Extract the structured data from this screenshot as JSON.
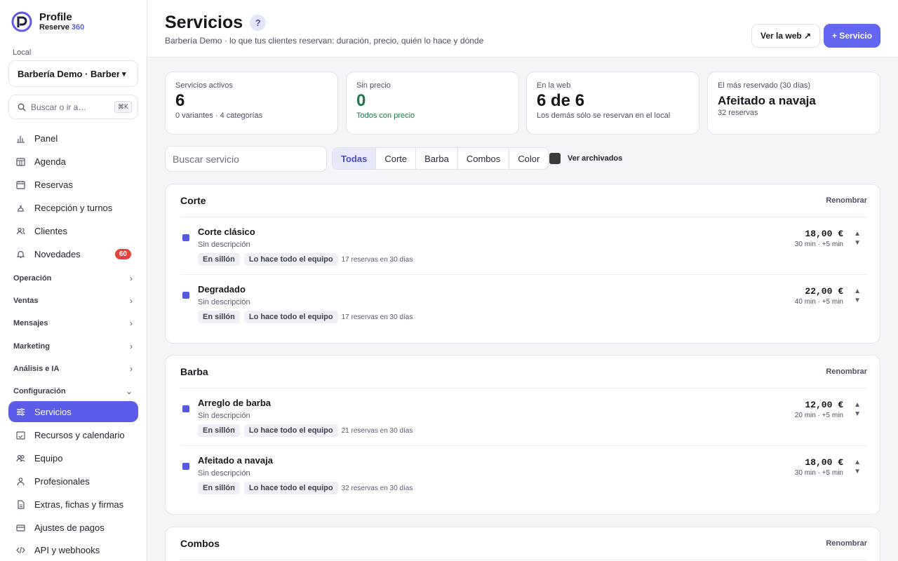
{
  "brand": {
    "line1": "Profile",
    "line2_prefix": "Reserve",
    "line2_accent": "360",
    "accent": "#5b5ce8"
  },
  "sidebar": {
    "local_label": "Local",
    "local_value": "Barbería Demo · Barbería",
    "search_placeholder": "Buscar o ir a…",
    "search_shortcut": "⌘K",
    "items": [
      {
        "label": "Panel",
        "icon": "chart-icon"
      },
      {
        "label": "Agenda",
        "icon": "calendar-grid-icon"
      },
      {
        "label": "Reservas",
        "icon": "calendar-icon"
      },
      {
        "label": "Recepción y turnos",
        "icon": "bell-desk-icon"
      },
      {
        "label": "Clientes",
        "icon": "users-icon"
      },
      {
        "label": "Novedades",
        "icon": "bell-icon",
        "badge": "60"
      }
    ],
    "groups": [
      "Operación",
      "Ventas",
      "Mensajes",
      "Marketing",
      "Análisis e IA",
      "Configuración"
    ],
    "config_items": [
      {
        "label": "Servicios",
        "icon": "sliders-icon",
        "active": true
      },
      {
        "label": "Recursos y calendario",
        "icon": "calendar-check-icon"
      },
      {
        "label": "Equipo",
        "icon": "team-icon"
      },
      {
        "label": "Profesionales",
        "icon": "person-icon"
      },
      {
        "label": "Extras, fichas y firmas",
        "icon": "document-icon"
      },
      {
        "label": "Ajustes de pagos",
        "icon": "card-icon"
      },
      {
        "label": "API y webhooks",
        "icon": "code-icon"
      }
    ]
  },
  "header": {
    "title": "Servicios",
    "help": "?",
    "subtitle": "Barbería Demo · lo que tus clientes reservan: duración, precio, quién lo hace y dónde",
    "view_web": "Ver la web ↗",
    "new_service": "+ Servicio"
  },
  "stats": [
    {
      "label": "Servicios activos",
      "value": "6",
      "sub": "0 variantes · 4 categorías"
    },
    {
      "label": "Sin precio",
      "value": "0",
      "sub": "Todos con precio"
    },
    {
      "label": "En la web",
      "value": "6 de 6",
      "sub": "Los demás sólo se reservan en el local"
    },
    {
      "label": "El más reservado (30 días)",
      "value": "Afeitado a navaja",
      "sub": "32 reservas"
    }
  ],
  "filters": {
    "search_placeholder": "Buscar servicio",
    "tabs": [
      "Todas",
      "Corte",
      "Barba",
      "Combos",
      "Color"
    ],
    "active_tab": "Todas",
    "archived_label": "Ver archivados"
  },
  "rename_label": "Renombrar",
  "categories": [
    {
      "name": "Corte",
      "services": [
        {
          "name": "Corte clásico",
          "desc": "Sin descripción",
          "chip1": "En sillón",
          "chip2": "Lo hace todo el equipo",
          "bookings": "17 reservas en 30 días",
          "price": "18,00 €",
          "duration": "30 min · +5 min"
        },
        {
          "name": "Degradado",
          "desc": "Sin descripción",
          "chip1": "En sillón",
          "chip2": "Lo hace todo el equipo",
          "bookings": "17 reservas en 30 días",
          "price": "22,00 €",
          "duration": "40 min · +5 min"
        }
      ]
    },
    {
      "name": "Barba",
      "services": [
        {
          "name": "Arreglo de barba",
          "desc": "Sin descripción",
          "chip1": "En sillón",
          "chip2": "Lo hace todo el equipo",
          "bookings": "21 reservas en 30 días",
          "price": "12,00 €",
          "duration": "20 min · +5 min"
        },
        {
          "name": "Afeitado a navaja",
          "desc": "Sin descripción",
          "chip1": "En sillón",
          "chip2": "Lo hace todo el equipo",
          "bookings": "32 reservas en 30 días",
          "price": "18,00 €",
          "duration": "30 min · +5 min"
        }
      ]
    },
    {
      "name": "Combos",
      "services": []
    }
  ]
}
